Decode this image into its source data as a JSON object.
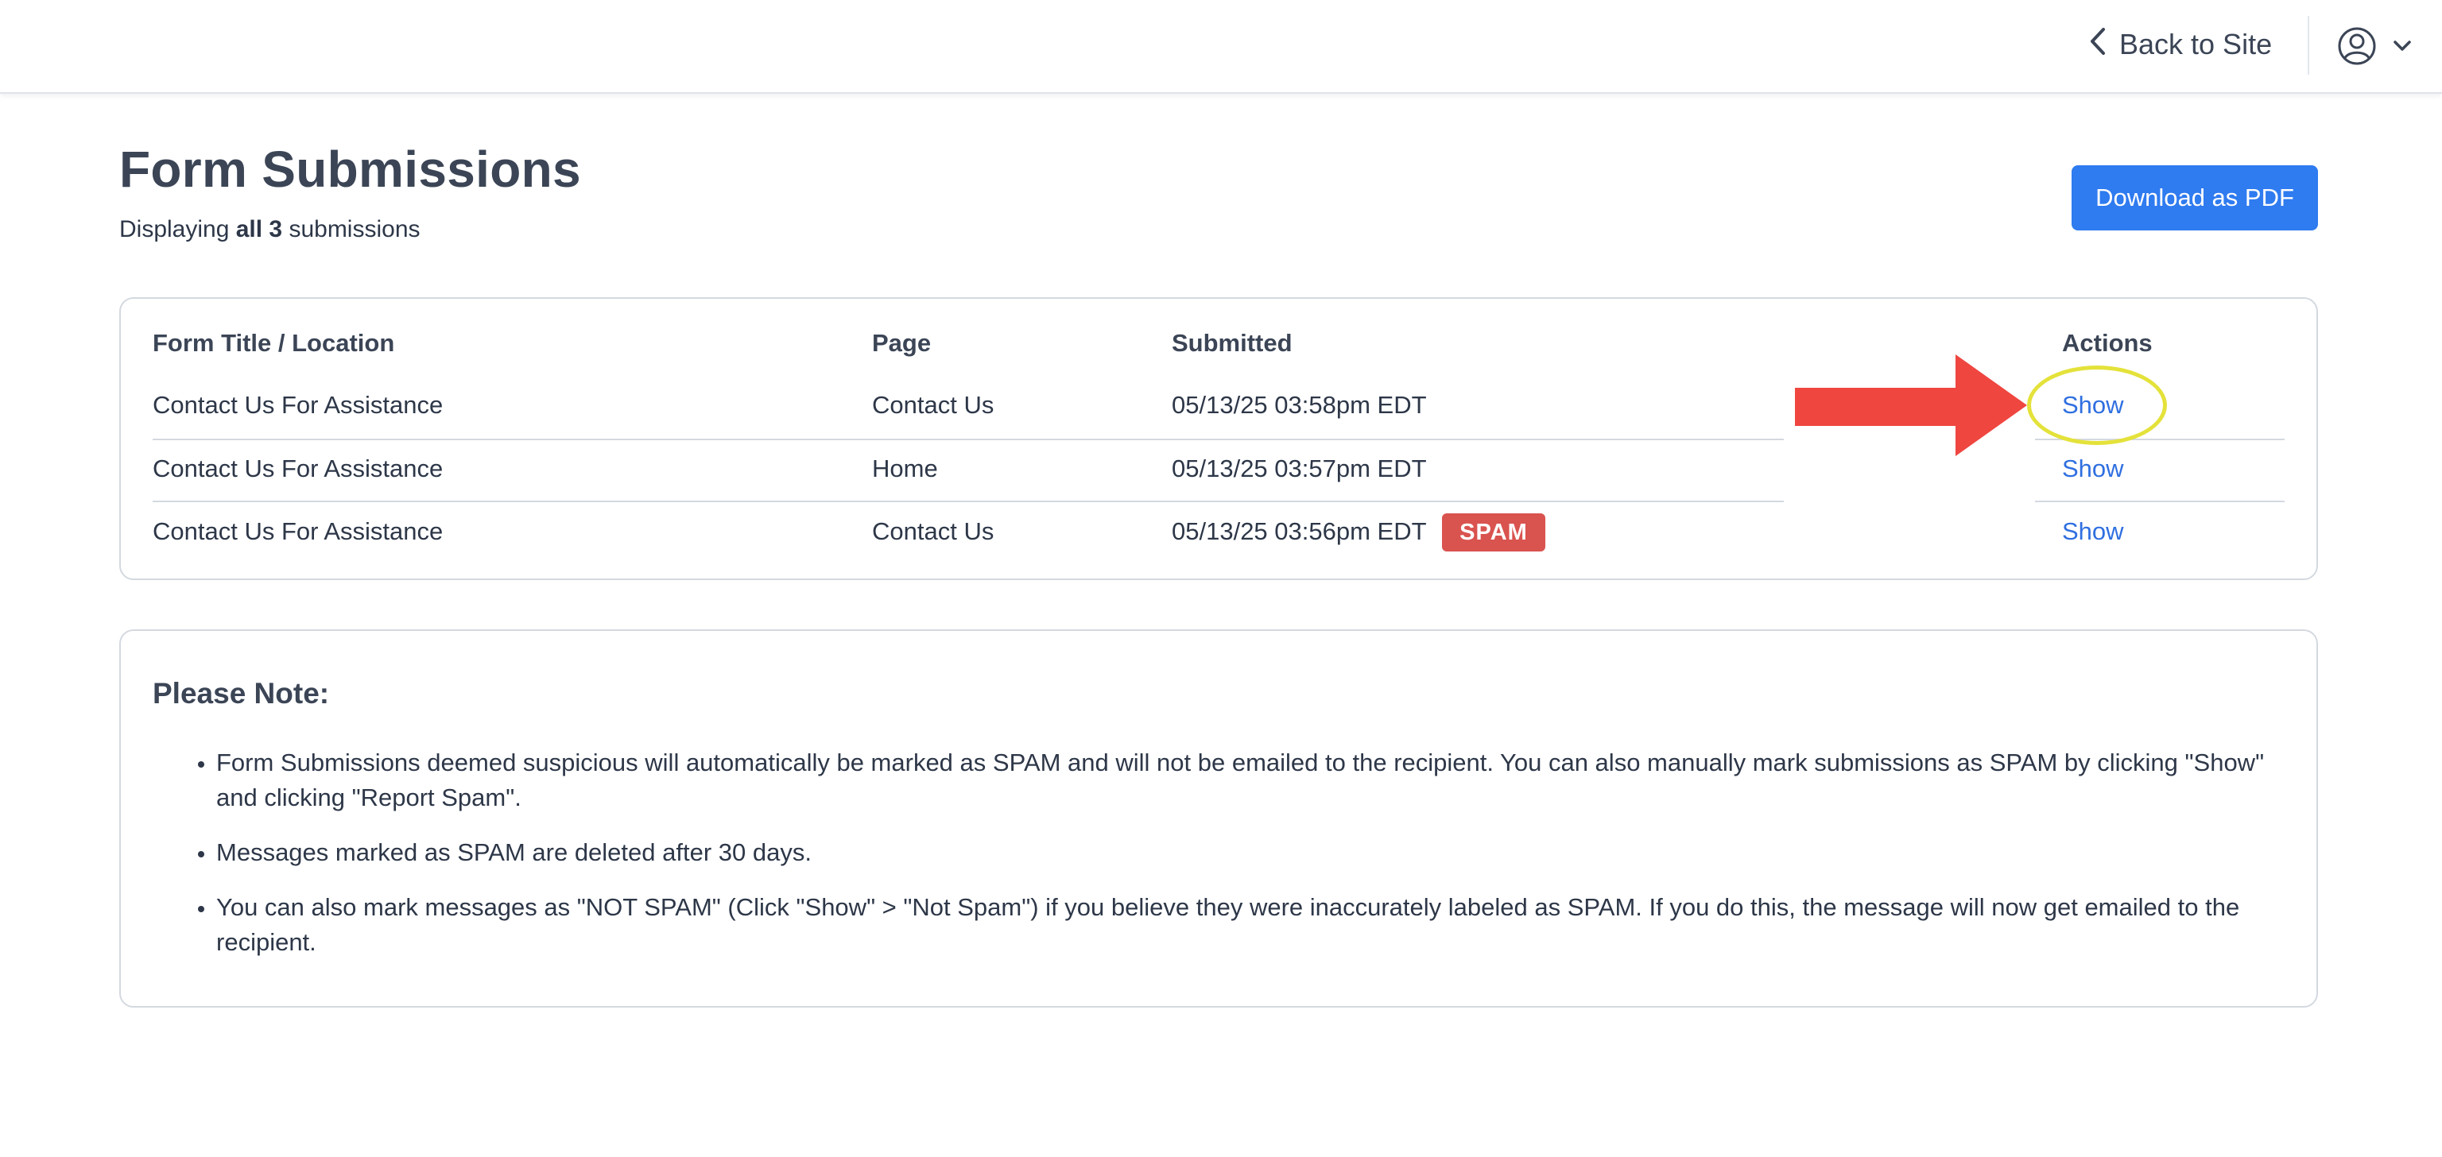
{
  "header": {
    "back_label": "Back to Site"
  },
  "page": {
    "title": "Form Submissions",
    "subtitle_prefix": "Displaying ",
    "subtitle_bold": "all 3",
    "subtitle_suffix": " submissions",
    "download_label": "Download as PDF"
  },
  "table": {
    "headers": {
      "form_title": "Form Title / Location",
      "page": "Page",
      "submitted": "Submitted",
      "actions": "Actions"
    },
    "rows": [
      {
        "form": "Contact Us For Assistance",
        "page": "Contact Us",
        "submitted": "05/13/25 03:58pm EDT",
        "action": "Show"
      },
      {
        "form": "Contact Us For Assistance",
        "page": "Home",
        "submitted": "05/13/25 03:57pm EDT",
        "action": "Show"
      },
      {
        "form": "Contact Us For Assistance",
        "page": "Contact Us",
        "submitted": "05/13/25 03:56pm EDT",
        "action": "Show",
        "badge": "SPAM"
      }
    ]
  },
  "note": {
    "heading": "Please Note:",
    "items": [
      "Form Submissions deemed suspicious will automatically be marked as SPAM and will not be emailed to the recipient. You can also manually mark submissions as SPAM by clicking \"Show\" and clicking \"Report Spam\".",
      "Messages marked as SPAM are deleted after 30 days.",
      "You can also mark messages as \"NOT SPAM\" (Click \"Show\" > \"Not Spam\") if you believe they were inaccurately labeled as SPAM. If you do this, the message will now get emailed to the recipient."
    ]
  },
  "icons": {
    "back": "chevron-left-icon",
    "user": "user-circle-icon",
    "caret": "chevron-down-icon"
  },
  "colors": {
    "primary": "#2f7bf0",
    "link": "#2f6fe0",
    "spam_badge": "#d9534f",
    "annotation_arrow": "#ef4640",
    "annotation_circle": "#e4e23a"
  }
}
